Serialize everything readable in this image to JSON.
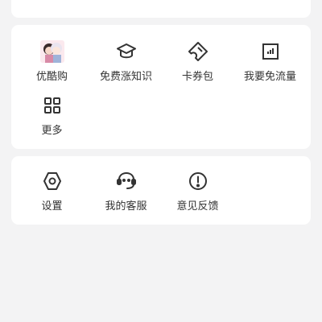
{
  "services": {
    "items": [
      {
        "label": "优酷购",
        "icon": "anime-avatar-icon"
      },
      {
        "label": "免费涨知识",
        "icon": "graduation-cap-icon"
      },
      {
        "label": "卡券包",
        "icon": "ticket-icon"
      },
      {
        "label": "我要免流量",
        "icon": "data-chart-icon"
      },
      {
        "label": "更多",
        "icon": "grid-icon"
      }
    ]
  },
  "settings": {
    "items": [
      {
        "label": "设置",
        "icon": "hexagon-gear-icon"
      },
      {
        "label": "我的客服",
        "icon": "customer-service-icon"
      },
      {
        "label": "意见反馈",
        "icon": "exclamation-circle-icon"
      }
    ]
  }
}
